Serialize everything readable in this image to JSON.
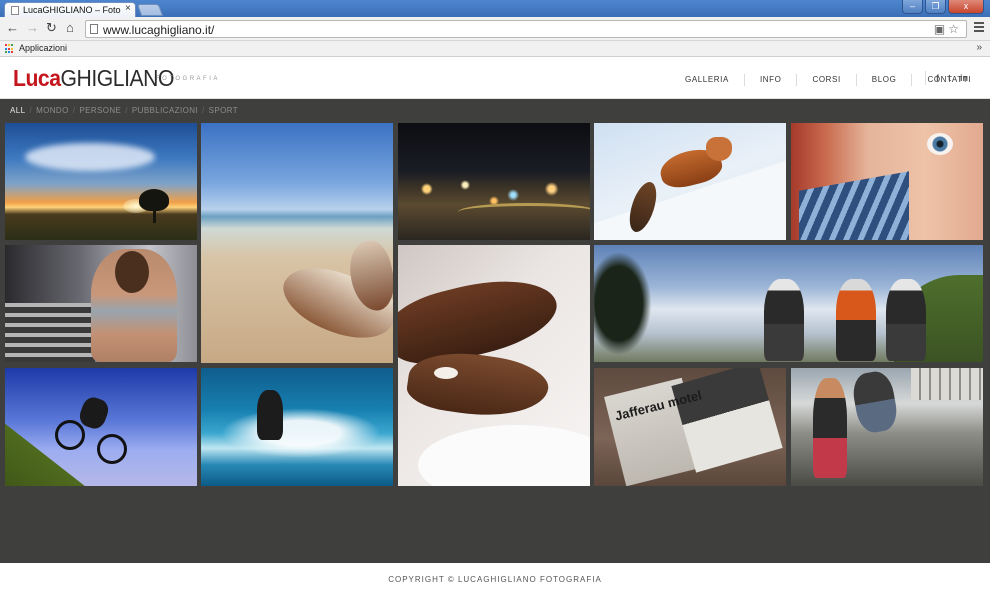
{
  "browser": {
    "tab_title": "LucaGHIGLIANO – Fotografia",
    "tab_close": "×",
    "url": "www.lucaghigliano.it/",
    "bookmarks": {
      "apps_label": "Applicazioni",
      "more": "»"
    },
    "window_buttons": {
      "minimize": "–",
      "maximize": "❐",
      "close": "x"
    },
    "nav_icons": {
      "back": "back-arrow-icon",
      "forward": "forward-arrow-icon",
      "reload": "reload-icon",
      "home": "home-icon"
    }
  },
  "site": {
    "logo": {
      "first": "Luca",
      "last": "GHIGLIANO",
      "tagline": "FOTOGRAFIA"
    },
    "nav": [
      {
        "label": "GALLERIA"
      },
      {
        "label": "INFO"
      },
      {
        "label": "CORSI"
      },
      {
        "label": "BLOG"
      },
      {
        "label": "CONTATTI"
      }
    ],
    "social": {
      "facebook": "f",
      "twitter": "t",
      "linkedin": "in"
    }
  },
  "gallery": {
    "filters": [
      {
        "label": "ALL",
        "active": true
      },
      {
        "label": "MONDO"
      },
      {
        "label": "PERSONE"
      },
      {
        "label": "PUBBLICAZIONI"
      },
      {
        "label": "SPORT"
      }
    ],
    "filter_separator": "/",
    "magazine_headline": "Jafferau motel"
  },
  "footer": {
    "copyright": "COPYRIGHT © LUCAGHIGLIANO FOTOGRAFIA"
  },
  "colors": {
    "brand_red": "#c4161c",
    "gallery_bg": "#3f3f3d",
    "chrome_blue": "#4d86cf"
  }
}
